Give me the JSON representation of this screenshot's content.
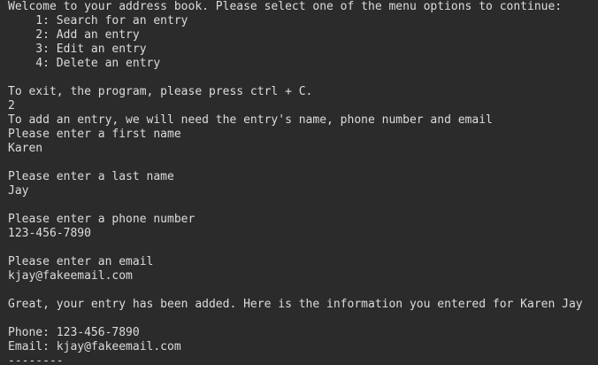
{
  "theme": {
    "background": "#2b2b2b",
    "foreground": "#dcdcdc"
  },
  "terminal": {
    "lines": [
      "Welcome to your address book. Please select one of the menu options to continue:",
      "    1: Search for an entry",
      "    2: Add an entry",
      "    3: Edit an entry",
      "    4: Delete an entry",
      "",
      "To exit, the program, please press ctrl + C.",
      "2",
      "To add an entry, we will need the entry's name, phone number and email",
      "Please enter a first name",
      "Karen",
      "",
      "Please enter a last name",
      "Jay",
      "",
      "Please enter a phone number",
      "123-456-7890",
      "",
      "Please enter an email",
      "kjay@fakeemail.com",
      "",
      "Great, your entry has been added. Here is the information you entered for Karen Jay",
      "",
      "Phone: 123-456-7890",
      "Email: kjay@fakeemail.com",
      "--------"
    ]
  }
}
